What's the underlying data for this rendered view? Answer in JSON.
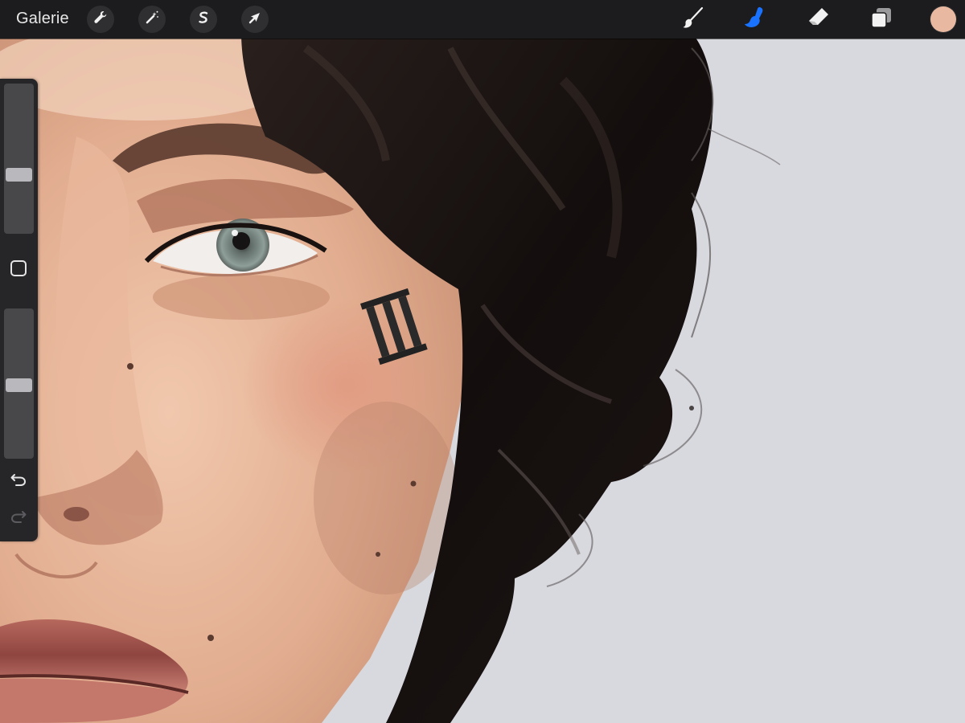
{
  "toolbar": {
    "gallery_label": "Galerie",
    "actions": [
      {
        "name": "modify-button",
        "icon": "wrench-icon"
      },
      {
        "name": "adjustments-button",
        "icon": "magic-wand-icon"
      },
      {
        "name": "selection-button",
        "icon": "selection-s-icon"
      },
      {
        "name": "transform-button",
        "icon": "arrow-cursor-icon"
      }
    ],
    "tools": [
      {
        "name": "brush-tool",
        "icon": "brush-icon",
        "active": false
      },
      {
        "name": "smudge-tool",
        "icon": "smudge-finger-icon",
        "active": true
      },
      {
        "name": "eraser-tool",
        "icon": "eraser-icon",
        "active": false
      },
      {
        "name": "layers-button",
        "icon": "layers-icon",
        "active": false
      }
    ],
    "current_color": "#e8b9a0",
    "active_tool_color": "#1a73ff"
  },
  "sidebar": {
    "brush_size_level": 0.38,
    "opacity_level": 0.49,
    "modify_icon": "square-icon",
    "undo_icon": "undo-icon",
    "redo_icon": "redo-icon",
    "redo_enabled": false
  },
  "canvas": {
    "background_color": "#d8d9de",
    "artwork": "digital-portrait-painting",
    "cheek_tattoo": "III"
  }
}
